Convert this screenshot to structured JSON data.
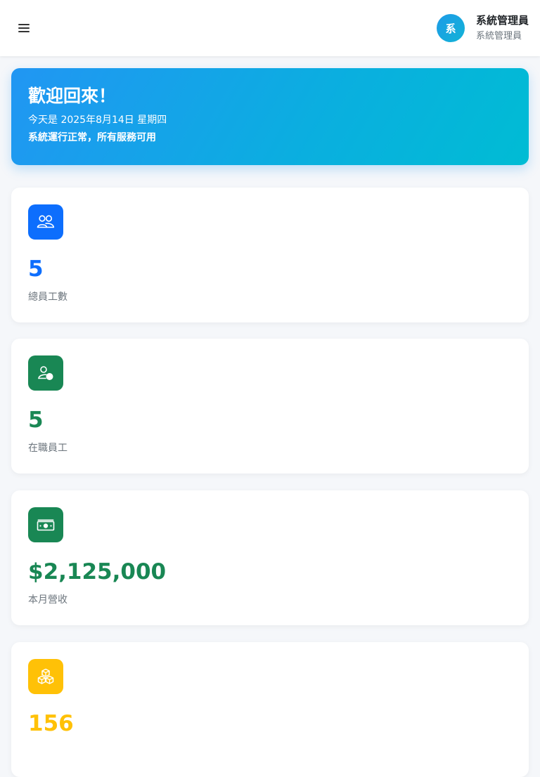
{
  "header": {
    "menu_icon": "hamburger-menu-icon",
    "avatar_initial": "系",
    "user_name": "系統管理員",
    "user_role": "系統管理員"
  },
  "welcome": {
    "title": "歡迎回來！",
    "date_line": "今天是 2025年8月14日 星期四",
    "status_line": "系統運行正常，所有服務可用"
  },
  "stats": [
    {
      "icon": "people-icon",
      "value": "5",
      "label": "總員工數",
      "color": "#0d6efd"
    },
    {
      "icon": "person-active-icon",
      "value": "5",
      "label": "在職員工",
      "color": "#198754"
    },
    {
      "icon": "cash-icon",
      "value": "$2,125,000",
      "label": "本月營收",
      "color": "#198754"
    },
    {
      "icon": "boxes-icon",
      "value": "156",
      "label": "",
      "color": "#ffc107"
    }
  ]
}
